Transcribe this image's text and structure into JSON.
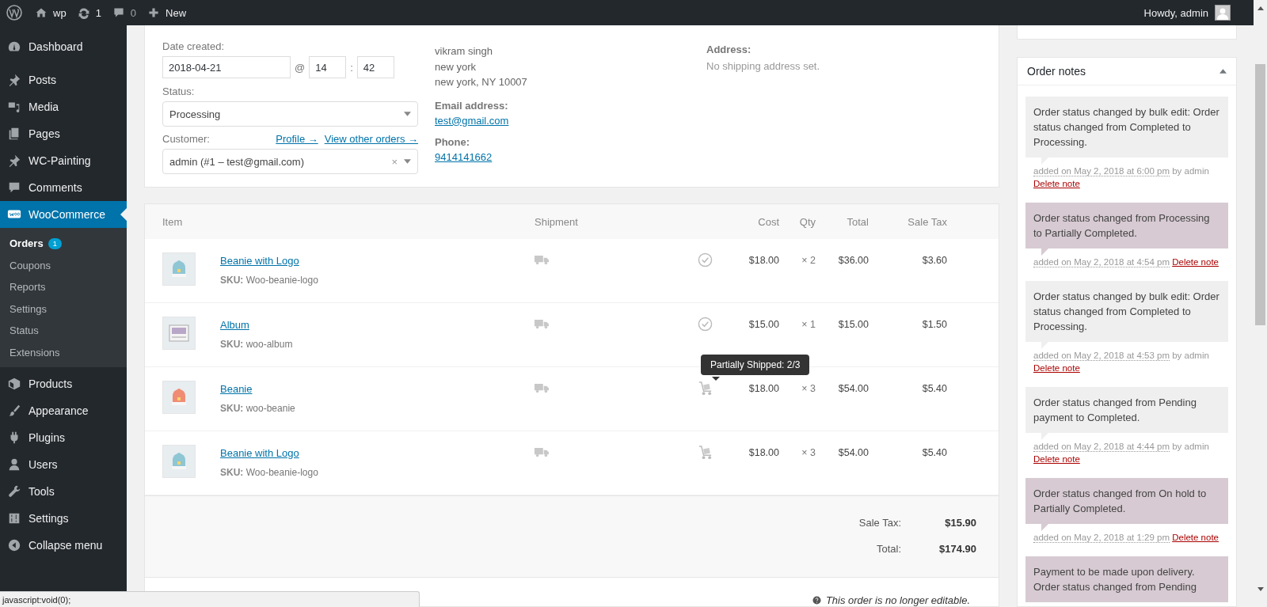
{
  "admin_bar": {
    "site": "wp",
    "updates": "1",
    "comments": "0",
    "new": "New",
    "greeting": "Howdy, admin"
  },
  "sidebar": {
    "items": [
      {
        "label": "Dashboard",
        "selected": false
      },
      {
        "label": "Posts",
        "selected": false
      },
      {
        "label": "Media",
        "selected": false
      },
      {
        "label": "Pages",
        "selected": false
      },
      {
        "label": "WC-Painting",
        "selected": false
      },
      {
        "label": "Comments",
        "selected": false
      },
      {
        "label": "WooCommerce",
        "selected": true,
        "children": [
          {
            "label": "Orders",
            "selected": true,
            "badge": "1"
          },
          {
            "label": "Coupons",
            "selected": false
          },
          {
            "label": "Reports",
            "selected": false
          },
          {
            "label": "Settings",
            "selected": false
          },
          {
            "label": "Status",
            "selected": false
          },
          {
            "label": "Extensions",
            "selected": false
          }
        ]
      },
      {
        "label": "Products",
        "selected": false
      },
      {
        "label": "Appearance",
        "selected": false
      },
      {
        "label": "Plugins",
        "selected": false
      },
      {
        "label": "Users",
        "selected": false
      },
      {
        "label": "Tools",
        "selected": false
      },
      {
        "label": "Settings",
        "selected": false
      },
      {
        "label": "Collapse menu",
        "selected": false
      }
    ]
  },
  "general": {
    "date_label": "Date created:",
    "date": "2018-04-21",
    "at": "@",
    "hour": "14",
    "colon": ":",
    "minute": "42",
    "status_label": "Status:",
    "status": "Processing",
    "customer_label": "Customer:",
    "profile_link": "Profile →",
    "orders_link": "View other orders →",
    "customer": "admin (#1 – test@gmail.com)",
    "clear": "×"
  },
  "billing": {
    "address": [
      "vikram singh",
      "new york",
      "new york, NY 10007"
    ],
    "email_label": "Email address:",
    "email": "test@gmail.com",
    "phone_label": "Phone:",
    "phone": "9414141662"
  },
  "shipping": {
    "address_label": "Address:",
    "address": "No shipping address set."
  },
  "items": {
    "columns": [
      "Item",
      "Shipment",
      "Cost",
      "Qty",
      "Total",
      "Sale Tax"
    ],
    "rows": [
      {
        "name": "Beanie with Logo",
        "sku_label": "SKU:",
        "sku": "Woo-beanie-logo",
        "kind": "shipped",
        "cost": "$18.00",
        "qty": "× 2",
        "total": "$36.00",
        "tax": "$3.60"
      },
      {
        "name": "Album",
        "sku_label": "SKU:",
        "sku": "woo-album",
        "kind": "shipped",
        "cost": "$15.00",
        "qty": "× 1",
        "total": "$15.00",
        "tax": "$1.50"
      },
      {
        "name": "Beanie",
        "sku_label": "SKU:",
        "sku": "woo-beanie",
        "kind": "partial",
        "tooltip": "Partially Shipped: 2/3",
        "cost": "$18.00",
        "qty": "× 3",
        "total": "$54.00",
        "tax": "$5.40"
      },
      {
        "name": "Beanie with Logo",
        "sku_label": "SKU:",
        "sku": "Woo-beanie-logo",
        "kind": "partial",
        "cost": "$18.00",
        "qty": "× 3",
        "total": "$54.00",
        "tax": "$5.40"
      }
    ],
    "totals": [
      {
        "label": "Sale Tax:",
        "value": "$15.90"
      },
      {
        "label": "Total:",
        "value": "$174.90"
      }
    ],
    "notice": "This order is no longer editable."
  },
  "order_notes": {
    "title": "Order notes",
    "notes": [
      {
        "text": "Order status changed by bulk edit: Order status changed from Completed to Processing.",
        "color": "#efefef",
        "date": "added on May 2, 2018 at 6:00 pm",
        "author": "by admin",
        "delete": "Delete note"
      },
      {
        "text": "Order status changed from Processing to Partially Completed.",
        "color": "#d7cad2",
        "date": "added on May 2, 2018 at 4:54 pm",
        "delete": "Delete note"
      },
      {
        "text": "Order status changed by bulk edit: Order status changed from Completed to Processing.",
        "color": "#efefef",
        "date": "added on May 2, 2018 at 4:53 pm",
        "author": "by admin",
        "delete": "Delete note"
      },
      {
        "text": "Order status changed from Pending payment to Completed.",
        "color": "#efefef",
        "date": "added on May 2, 2018 at 4:44 pm",
        "author": "by admin",
        "delete": "Delete note"
      },
      {
        "text": "Order status changed from On hold to Partially Completed.",
        "color": "#d7cad2",
        "date": "added on May 2, 2018 at 1:29 pm",
        "delete": "Delete note"
      },
      {
        "text": "Payment to be made upon delivery. Order status changed from Pending",
        "color": "#d7cad2"
      }
    ]
  },
  "status_bar": "javascript:void(0);"
}
